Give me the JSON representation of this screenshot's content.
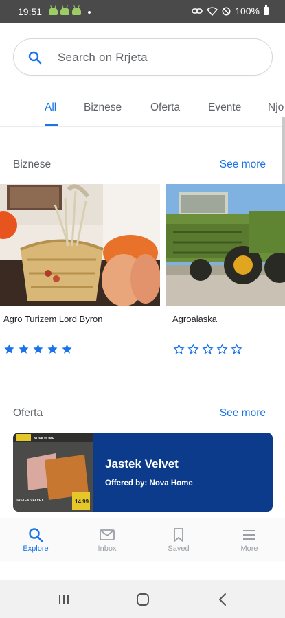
{
  "status_bar": {
    "time": "19:51",
    "battery": "100%"
  },
  "search": {
    "placeholder": "Search on Rrjeta",
    "icon": "search-icon"
  },
  "tabs": [
    {
      "label": "All",
      "active": true
    },
    {
      "label": "Biznese",
      "active": false
    },
    {
      "label": "Oferta",
      "active": false
    },
    {
      "label": "Evente",
      "active": false
    },
    {
      "label": "Njo",
      "active": false
    }
  ],
  "sections": {
    "biznese": {
      "title": "Biznese",
      "see_more": "See more"
    },
    "oferta": {
      "title": "Oferta",
      "see_more": "See more"
    }
  },
  "businesses": [
    {
      "name": "Agro Turizem Lord Byron",
      "rating": 5
    },
    {
      "name": "Agroalaska",
      "rating": 0
    }
  ],
  "offer": {
    "title": "Jastek Velvet",
    "subtitle": "Offered by: Nova Home",
    "image_brand_text": "NOVA HOME",
    "image_price_text": "14.99",
    "image_caption": "JASTEK VELVET"
  },
  "bottom_nav": [
    {
      "label": "Explore",
      "icon": "search-icon",
      "active": true
    },
    {
      "label": "Inbox",
      "icon": "mail-icon",
      "active": false
    },
    {
      "label": "Saved",
      "icon": "bookmark-icon",
      "active": false
    },
    {
      "label": "More",
      "icon": "menu-icon",
      "active": false
    }
  ],
  "colors": {
    "accent": "#1a73e8",
    "offer_bg": "#0d3b8c",
    "status_bar": "#4a4a4a"
  }
}
